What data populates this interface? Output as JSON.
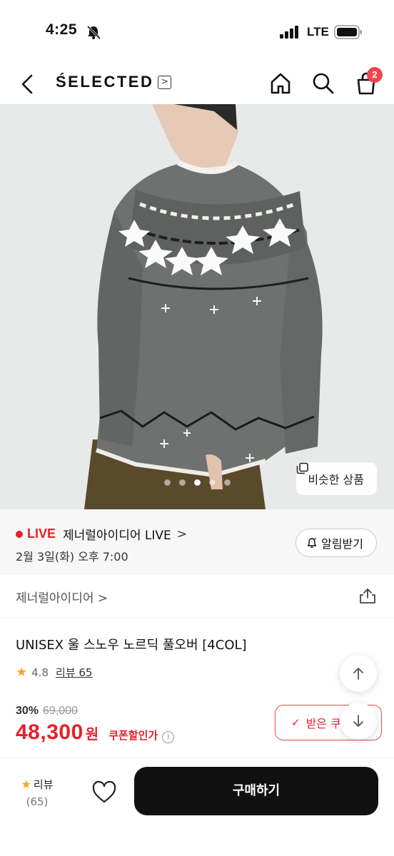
{
  "status": {
    "time": "4:25",
    "network": "LTE"
  },
  "nav": {
    "brand": "ŚELECTED",
    "brand_arrow": ">",
    "cart_count": "2"
  },
  "hero": {
    "similar_label": "비슷한 상품",
    "dot_count": 5,
    "active_dot": 2
  },
  "live": {
    "tag": "LIVE",
    "title": "제너럴아이디어 LIVE",
    "chevron": ">",
    "date": "2월 3일(화) 오후 7:00",
    "alarm_label": "알림받기"
  },
  "seller": {
    "name": "제너럴아이디어 >"
  },
  "product": {
    "title": "UNISEX 울 스노우 노르딕 풀오버 [4COL]",
    "rating": "4.8",
    "review_label": "리뷰 65",
    "discount_rate": "30%",
    "original_price": "69,000",
    "sale_price": "48,300",
    "price_unit": "원",
    "coupon_text": "쿠폰할인가",
    "coupon_button_label": "받은 쿠"
  },
  "bottom": {
    "review_label": "리뷰",
    "review_count": "(65)",
    "buy_label": "구매하기"
  },
  "colors": {
    "accent_red": "#e8202a",
    "badge_red": "#f0454a",
    "buy_black": "#111111",
    "star": "#f5a623"
  },
  "icons": [
    "back-icon",
    "home-icon",
    "search-icon",
    "cart-icon",
    "copy-icon",
    "bell-icon",
    "share-icon",
    "star-icon",
    "info-icon",
    "check-icon",
    "arrow-up-icon",
    "arrow-down-icon",
    "heart-icon",
    "mute-icon",
    "signal-icon",
    "battery-icon"
  ]
}
